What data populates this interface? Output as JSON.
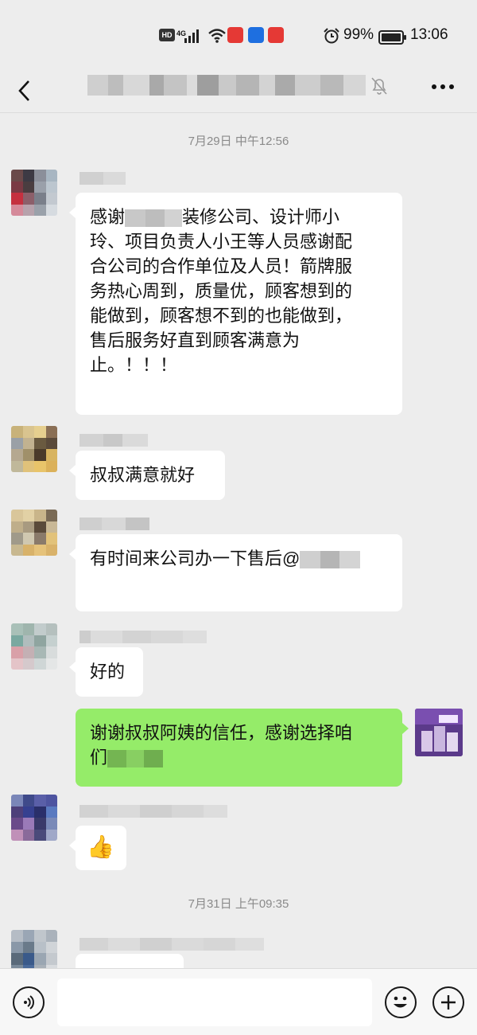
{
  "status_bar": {
    "hd": "HD",
    "network": "4G",
    "battery_percent": "99%",
    "time": "13:06"
  },
  "nav": {
    "back_icon": "chevron-left-icon",
    "mute_icon": "bell-off-icon",
    "more_icon": "more-dots-icon"
  },
  "chat": {
    "timestamps": [
      "7月29日 中午12:56",
      "7月31日 上午09:35"
    ],
    "messages": [
      {
        "side": "left",
        "lines": [
          "感谢",
          "装修公司、设计师小",
          "玲、项目负责人小王等人员感谢配",
          "合公司的合作单位及人员！箭牌服",
          "务热心周到，质量优，顾客想到的",
          "能做到，顾客想不到的也能做到，",
          "售后服务好直到顾客满意为",
          "止。！！！"
        ]
      },
      {
        "side": "left",
        "text": "叔叔满意就好"
      },
      {
        "side": "left",
        "text": "有时间来公司办一下售后@"
      },
      {
        "side": "left",
        "text": "好的"
      },
      {
        "side": "right",
        "line1": "谢谢叔叔阿姨的信任，感谢选择咱",
        "line2": "们"
      },
      {
        "side": "left",
        "emoji": "👍",
        "emoji_name": "thumbs-up-icon"
      }
    ]
  },
  "input_bar": {
    "voice_icon": "voice-icon",
    "emoji_icon": "smiley-icon",
    "plus_icon": "plus-icon",
    "placeholder": ""
  }
}
